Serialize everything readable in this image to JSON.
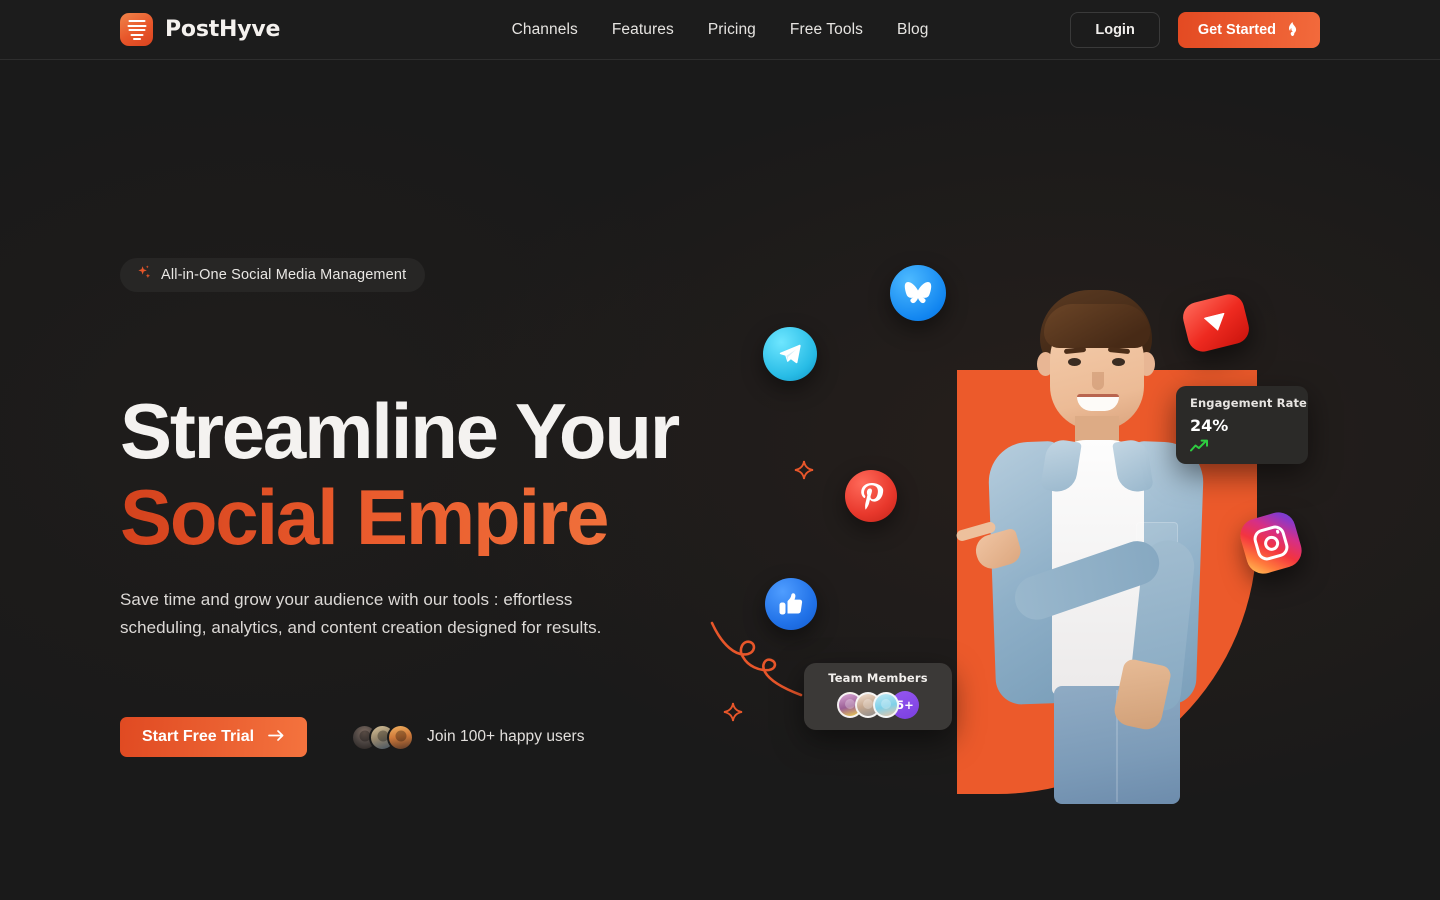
{
  "brand": {
    "name": "PostHyve",
    "logo_icon": "hive-logo-icon",
    "accent": "#e8562a"
  },
  "nav": {
    "items": [
      {
        "label": "Channels"
      },
      {
        "label": "Features"
      },
      {
        "label": "Pricing"
      },
      {
        "label": "Free Tools"
      },
      {
        "label": "Blog"
      }
    ]
  },
  "header_actions": {
    "login_label": "Login",
    "get_started_label": "Get Started",
    "get_started_icon": "flame-icon"
  },
  "hero": {
    "badge": {
      "icon": "sparkle-icon",
      "text": "All-in-One Social Media Management"
    },
    "headline_line1": "Streamline Your",
    "headline_line2": "Social Empire",
    "subtitle": "Save time and grow your audience with our tools : effortless scheduling, analytics, and content creation designed for results.",
    "cta_label": "Start Free Trial",
    "cta_icon": "arrow-right-icon",
    "social_proof_text": "Join 100+ happy users",
    "avatar_count": 3
  },
  "visual": {
    "hero_image_alt": "man-pointing",
    "orange_shape_color": "#ec5a2b",
    "social_icons": [
      {
        "name": "bluesky-icon"
      },
      {
        "name": "telegram-icon"
      },
      {
        "name": "pinterest-icon"
      },
      {
        "name": "facebook-like-icon"
      },
      {
        "name": "youtube-icon"
      },
      {
        "name": "instagram-icon"
      }
    ],
    "engagement_card": {
      "label": "Engagement Rate",
      "value": "24%",
      "trend_icon": "trending-up-icon",
      "trend_color": "#2ecc40"
    },
    "team_card": {
      "label": "Team Members",
      "overflow_label": "5+",
      "avatar_count": 3,
      "overflow_color": "#7b3fe0"
    }
  }
}
